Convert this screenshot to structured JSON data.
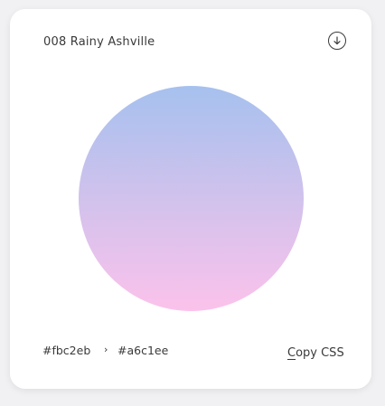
{
  "card": {
    "title": "008 Rainy Ashville",
    "download_icon": "download-arrow-icon"
  },
  "gradient": {
    "top_color": "#a6c1ee",
    "bottom_color": "#fbc2eb"
  },
  "footer": {
    "from_color": "#fbc2eb",
    "arrow": "›",
    "to_color": "#a6c1ee",
    "copy_first_letter": "C",
    "copy_rest": "opy CSS"
  }
}
